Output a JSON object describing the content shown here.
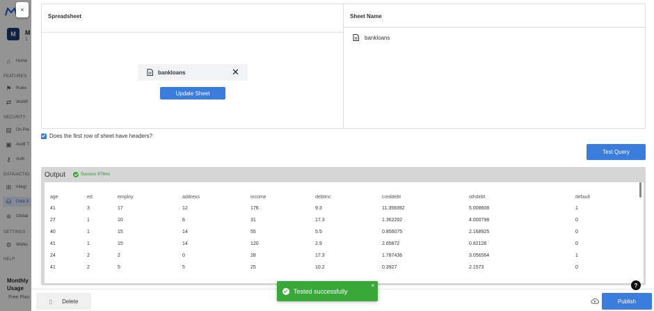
{
  "sidebar": {
    "avatar_initial": "M",
    "user_name": "M",
    "user_sub": "1",
    "sections": {
      "features": "FEATURES",
      "security": "SECURITY",
      "data": "DATA/ACTIO",
      "settings": "SETTINGS",
      "help": "HELP"
    },
    "items": {
      "home": "Home",
      "rules": "Rules",
      "workflows": "Workfl",
      "on_prem": "On Pre",
      "audit": "Audit T",
      "auth": "Auth",
      "integrations": "Integr",
      "data_sources": "Data S",
      "global": "Global",
      "workspace": "Works"
    },
    "usage_line1": "Monthly",
    "usage_line2": "Usage",
    "plan": "Free Plan"
  },
  "modal": {
    "close_glyph": "×",
    "spreadsheet_header": "Spreadsheet",
    "sheet_name_header": "Sheet Name",
    "file_name": "bankloans",
    "file_remove_glyph": "✕",
    "update_button": "Update Sheet",
    "sheet_item": "bankloans",
    "headers_checkbox_label": "Does the first row of sheet have headers?",
    "test_query_button": "Test Query",
    "output_title": "Output",
    "success_text": "Success 879ms",
    "table": {
      "columns": [
        "age",
        "ed",
        "employ",
        "address",
        "income",
        "debtinc",
        "creddebt",
        "othdebt",
        "default"
      ],
      "rows": [
        [
          "41",
          "3",
          "17",
          "12",
          "176",
          "9.3",
          "11.359392",
          "5.008608",
          "1"
        ],
        [
          "27",
          "1",
          "10",
          "6",
          "31",
          "17.3",
          "1.362202",
          "4.000798",
          "0"
        ],
        [
          "40",
          "1",
          "15",
          "14",
          "55",
          "5.5",
          "0.856075",
          "2.168925",
          "0"
        ],
        [
          "41",
          "1",
          "15",
          "14",
          "120",
          "2.9",
          "2.65872",
          "0.82128",
          "0"
        ],
        [
          "24",
          "2",
          "2",
          "0",
          "28",
          "17.3",
          "1.787436",
          "3.056564",
          "1"
        ],
        [
          "41",
          "2",
          "5",
          "5",
          "25",
          "10.2",
          "0.3927",
          "2.1573",
          "0"
        ]
      ]
    },
    "delete_button": "Delete",
    "publish_button": "Publish",
    "help_glyph": "?"
  },
  "toast": {
    "message": "Tested successfully",
    "close_glyph": "×"
  },
  "colors": {
    "primary": "#3b7ddd",
    "success": "#38a838",
    "brand": "#2b64d9"
  }
}
